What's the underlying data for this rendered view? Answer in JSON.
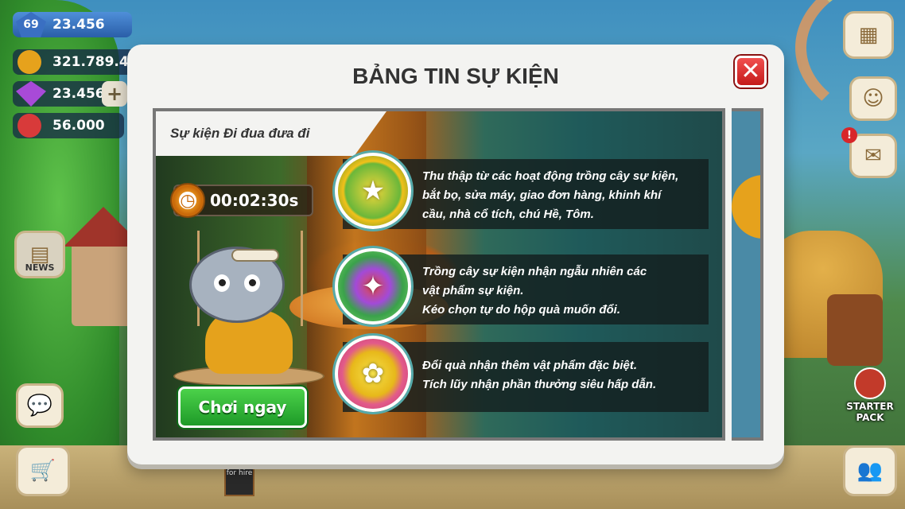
{
  "hud": {
    "level": "69",
    "level_points": "23.456",
    "coins": "321.789.456",
    "gems": "23.456",
    "hearts": "56.000",
    "plus_label": "+"
  },
  "side_buttons": {
    "news_label": "NEWS",
    "starter_pack_label": "STARTER PACK",
    "mail_badge": "!"
  },
  "modal": {
    "title": "BẢNG TIN SỰ KIỆN",
    "close_label": "✕",
    "event_name": "Sự kiện Đi đua đưa đi",
    "timer": "00:02:30s",
    "play_button": "Chơi ngay",
    "features": [
      {
        "icon": "star-sprite-icon",
        "text": "Thu thập từ các hoạt động trồng cây sự kiện,\nbắt bọ, sửa máy, giao đơn hàng, khinh khí\ncầu, nhà cổ tích, chú Hề, Tôm."
      },
      {
        "icon": "rocket-fireworks-icon",
        "text": "Trồng cây sự kiện nhận ngẫu nhiên các\nvật phẩm sự kiện.\nKéo chọn tự do hộp quà muốn đổi."
      },
      {
        "icon": "gift-bag-icon",
        "text": "Đổi quà nhận thêm vật phẩm đặc biệt.\nTích lũy nhận phần thưởng siêu hấp dẫn."
      }
    ]
  },
  "background": {
    "sign_text": "for hire"
  },
  "colors": {
    "play_green": "#2fb42a",
    "close_red": "#d8262a",
    "modal_bg": "#f3f3f1"
  }
}
